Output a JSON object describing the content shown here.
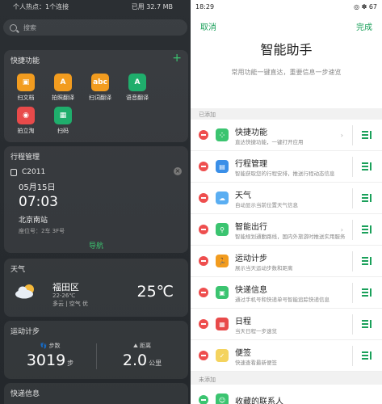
{
  "left": {
    "status": {
      "left": "个人热点：1个连接",
      "right": "已用 32.7 MB"
    },
    "search_placeholder": "搜索",
    "quick": {
      "title": "快捷功能",
      "items": [
        {
          "label": "扫文档",
          "color": "#f29c1f",
          "glyph": "▣"
        },
        {
          "label": "拍照翻译",
          "color": "#f29c1f",
          "glyph": "A"
        },
        {
          "label": "扫词翻译",
          "color": "#f29c1f",
          "glyph": "abc"
        },
        {
          "label": "语音翻译",
          "color": "#1fae6c",
          "glyph": "A"
        },
        {
          "label": "拍立淘",
          "color": "#e84a4a",
          "glyph": "◉"
        },
        {
          "label": "扫码",
          "color": "#1fae6c",
          "glyph": "▦"
        }
      ]
    },
    "schedule": {
      "title": "行程管理",
      "train": "C2011",
      "date": "05月15日",
      "time": "07:03",
      "station": "北京南站",
      "seat": "座位号：2车 3F号",
      "nav": "导航"
    },
    "weather": {
      "title": "天气",
      "city": "福田区",
      "range": "22-26℃",
      "cond": "多云 | 空气 优",
      "temp": "25℃"
    },
    "steps": {
      "title": "运动计步",
      "steps_label": "步数",
      "steps_value": "3019",
      "steps_unit": "步",
      "dist_label": "距离",
      "dist_value": "2.0",
      "dist_unit": "公里"
    },
    "express": {
      "title": "快递信息"
    }
  },
  "right": {
    "status": {
      "left": "18:29",
      "right": "◎ ✽ 67"
    },
    "cancel": "取消",
    "done": "完成",
    "title": "智能助手",
    "subtitle": "常用功能一键直达，重要信息一步速览",
    "section_added": "已添加",
    "section_unadded": "未添加",
    "items": [
      {
        "name": "快捷功能",
        "desc": "直达快捷功能，一键打开应用",
        "color": "#3bc470",
        "glyph": "⁘",
        "chev": "›"
      },
      {
        "name": "行程管理",
        "desc": "智能获取您的行程安排，推送行程动态信息",
        "color": "#3a8fe8",
        "glyph": "▤",
        "chev": ""
      },
      {
        "name": "天气",
        "desc": "自动显示当前位置天气信息",
        "color": "#5aaef2",
        "glyph": "☁",
        "chev": ""
      },
      {
        "name": "智能出行",
        "desc": "智能规划通勤路线，国内外旅游时推送实用服务",
        "color": "#3bc470",
        "glyph": "⚲",
        "chev": "›"
      },
      {
        "name": "运动计步",
        "desc": "展示当天运动步数和距离",
        "color": "#f29c1f",
        "glyph": "🏃",
        "chev": ""
      },
      {
        "name": "快递信息",
        "desc": "通过手机号和快递单号智能追踪快递信息",
        "color": "#3bc470",
        "glyph": "▣",
        "chev": ""
      },
      {
        "name": "日程",
        "desc": "当天日程一步速览",
        "color": "#e84a4a",
        "glyph": "▦",
        "chev": ""
      },
      {
        "name": "便签",
        "desc": "快速查看最新便签",
        "color": "#f4d35e",
        "glyph": "✓",
        "chev": ""
      }
    ],
    "partial_item": "收藏的联系人"
  }
}
